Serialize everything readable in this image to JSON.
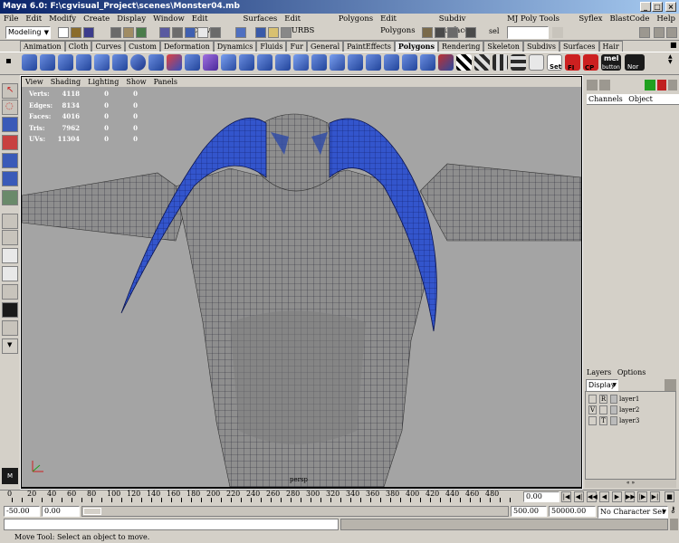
{
  "window": {
    "title": "Maya 6.0: F:\\cgvisual_Project\\scenes\\Monster04.mb",
    "minimize": "_",
    "maximize": "□",
    "close": "×"
  },
  "menubar": [
    "File",
    "Edit",
    "Modify",
    "Create",
    "Display",
    "Window",
    "Edit Curves",
    "Surfaces",
    "Edit NURBS",
    "Polygons",
    "Edit Polygons",
    "Subdiv Surfaces",
    "MJ Poly Tools 1.3",
    "Syflex",
    "BlastCode",
    "Help"
  ],
  "statusline": {
    "mode": "Modeling",
    "sel_label": "sel",
    "sel_value": ""
  },
  "shelf_tabs": [
    "Animation",
    "Cloth",
    "Curves",
    "Custom",
    "Deformation",
    "Dynamics",
    "Fluids",
    "Fur",
    "General",
    "PaintEffects",
    "Polygons",
    "Rendering",
    "Skeleton",
    "Subdivs",
    "Surfaces",
    "Hair"
  ],
  "shelf_active": "Polygons",
  "shelf_labels": {
    "set": "Set",
    "fl": "FI",
    "cp": "CP",
    "mel": "mel",
    "melsub": "button",
    "nor": "Nor"
  },
  "panel_menu": [
    "View",
    "Shading",
    "Lighting",
    "Show",
    "Panels"
  ],
  "hud": [
    {
      "label": "Verts:",
      "a": "4118",
      "b": "0",
      "c": "0"
    },
    {
      "label": "Edges:",
      "a": "8134",
      "b": "0",
      "c": "0"
    },
    {
      "label": "Faces:",
      "a": "4016",
      "b": "0",
      "c": "0"
    },
    {
      "label": "Tris:",
      "a": "7962",
      "b": "0",
      "c": "0"
    },
    {
      "label": "UVs:",
      "a": "11304",
      "b": "0",
      "c": "0"
    }
  ],
  "camera": "persp",
  "channel_box": {
    "tabs": [
      "Channels",
      "Object"
    ]
  },
  "layers": {
    "menu": [
      "Layers",
      "Options"
    ],
    "display": "Display",
    "rows": [
      {
        "v": "",
        "t": "R",
        "name": "layer1"
      },
      {
        "v": "V",
        "t": "",
        "name": "layer2"
      },
      {
        "v": "",
        "t": "T",
        "name": "layer3"
      }
    ]
  },
  "timeline": {
    "ticks": [
      "20",
      "40",
      "60",
      "80",
      "100",
      "120",
      "140",
      "160",
      "180",
      "200",
      "220",
      "240",
      "260",
      "280",
      "300",
      "320",
      "340",
      "360",
      "380",
      "400",
      "420",
      "440",
      "460",
      "480"
    ],
    "start_tick": "0",
    "current_frame": "0.00"
  },
  "range": {
    "start": "-50.00",
    "inner_start": "0.00",
    "inner_end": "500.00",
    "end": "50000.00",
    "character": "No Character Set"
  },
  "help": "Move Tool: Select an object to move.",
  "colors": {
    "viewport_bg": "#a4a4a4",
    "mesh": "#8e8e8e",
    "horns": "#3355cc",
    "title_from": "#0a246a",
    "title_to": "#a6caf0"
  }
}
